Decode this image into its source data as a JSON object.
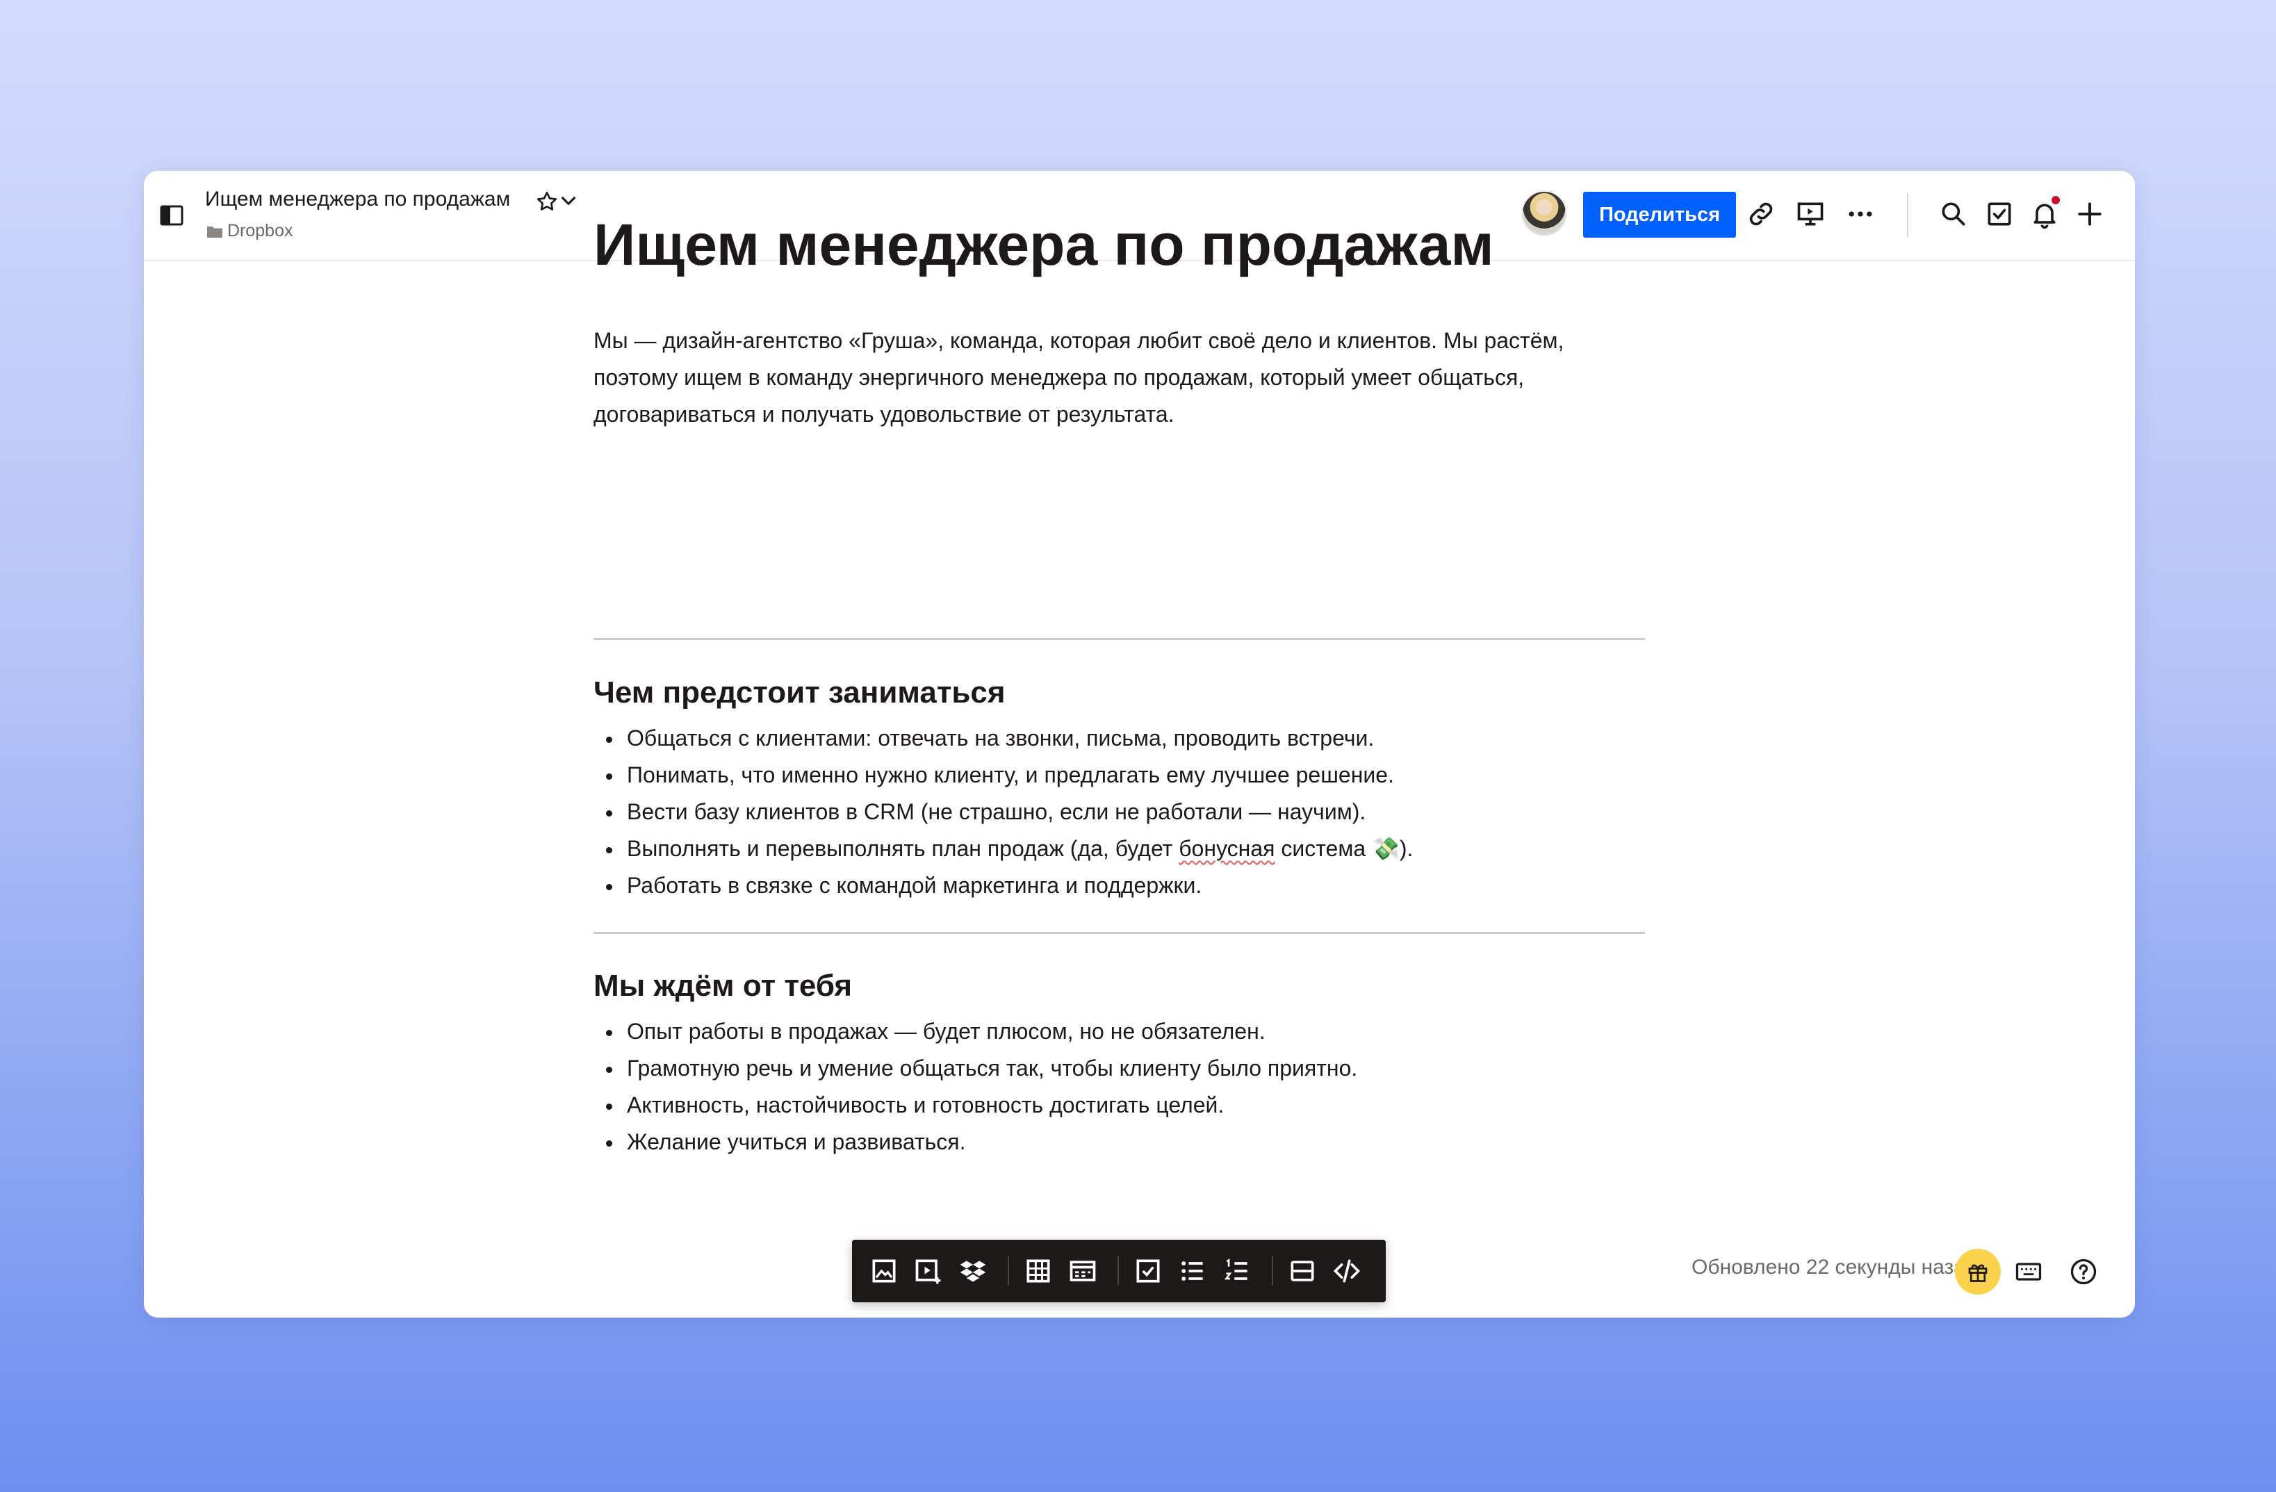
{
  "document": {
    "header_title": "Ищем менеджера по продажам",
    "breadcrumb": "Dropbox"
  },
  "header": {
    "share_label": "Поделиться",
    "icons": [
      "sidebar-toggle-icon",
      "star-icon",
      "chevron-down-icon",
      "avatar",
      "link-icon",
      "present-icon",
      "more-icon",
      "search-icon",
      "checklist-icon",
      "bell-icon",
      "plus-icon"
    ]
  },
  "page": {
    "title": "Ищем менеджера по продажам",
    "intro_lines": [
      "Мы — дизайн-агентство «Груша», команда, которая любит своё дело и клиентов. Мы растём,",
      "поэтому ищем в команду энергичного менеджера по продажам, который умеет общаться,",
      "договариваться и получать удовольствие от результата."
    ],
    "sections": [
      {
        "title": "Чем предстоит заниматься",
        "items": [
          "Общаться с клиентами: отвечать на звонки, письма, проводить встречи.",
          "Понимать, что именно нужно клиенту, и предлагать ему лучшее решение.",
          "Вести базу клиентов в CRM (не страшно, если не работали — научим).",
          "Выполнять и перевыполнять план продаж (да, будет бонусная система 💸).",
          "Работать в связке с командой маркетинга и поддержки."
        ]
      },
      {
        "title": "Мы ждём от тебя",
        "items": [
          "Опыт работы в продажах — будет плюсом, но не обязателен.",
          "Грамотную речь и умение общаться так, чтобы клиенту было приятно.",
          "Активность, настойчивость и готовность достигать целей.",
          "Желание учиться и развиваться."
        ]
      }
    ]
  },
  "insert_toolbar": {
    "icons": [
      "image-icon",
      "video-icon",
      "dropbox-icon",
      "table-icon",
      "timeline-icon",
      "checkbox-icon",
      "bulleted-list-icon",
      "numbered-list-icon",
      "divider-icon",
      "code-icon"
    ]
  },
  "footer": {
    "status": "Обновлено 22 секунды назад",
    "icons": [
      "gift-icon",
      "keyboard-icon",
      "help-icon"
    ]
  },
  "colors": {
    "accent": "#0061fe",
    "gift": "#fad24b",
    "notification": "#c8102e",
    "text": "#1e1919"
  }
}
